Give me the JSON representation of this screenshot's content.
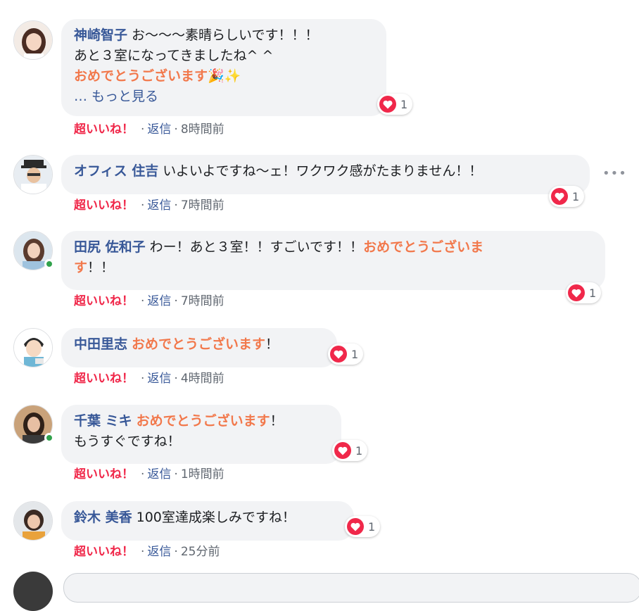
{
  "colors": {
    "author": "#385898",
    "accent_orange": "#f2784b",
    "super_like": "#f0284a",
    "bubble_bg": "#f2f3f5"
  },
  "actions": {
    "super_like": "超いいね！",
    "reply": "返信",
    "separator": "·"
  },
  "comments": [
    {
      "author": "神崎智子",
      "line1": "お〜〜〜素晴らしいです！！！",
      "line2": "あと３室になってきましたね^ ^",
      "line3_orange": "おめでとうございます",
      "line3_emoji": "🎉✨",
      "more": "… もっと見る",
      "reaction_count": "1",
      "time": "8時間前",
      "online": false
    },
    {
      "author": "オフィス 住吉",
      "text": "いよいよですね〜ェ！ワクワク感がたまりません！！",
      "reaction_count": "1",
      "time": "7時間前",
      "online": false
    },
    {
      "author": "田尻 佐和子",
      "text_a": "わー！あと３室！！すごいです！！",
      "text_orange_a": "おめでとうございま",
      "text_orange_b": "す",
      "text_b": "！！",
      "reaction_count": "1",
      "time": "7時間前",
      "online": true
    },
    {
      "author": "中田里志",
      "text_orange": "おめでとうございます",
      "text": "！",
      "reaction_count": "1",
      "time": "4時間前",
      "online": false
    },
    {
      "author": "千葉 ミキ",
      "text_orange": "おめでとうございます",
      "text": "！",
      "line2": "もうすぐですね！",
      "reaction_count": "1",
      "time": "1時間前",
      "online": true
    },
    {
      "author": "鈴木 美香",
      "text": "100室達成楽しみですね！",
      "reaction_count": "1",
      "time": "25分前",
      "online": false
    }
  ],
  "more_options_icon": "ellipsis-icon",
  "reaction_icon": "heart-icon"
}
